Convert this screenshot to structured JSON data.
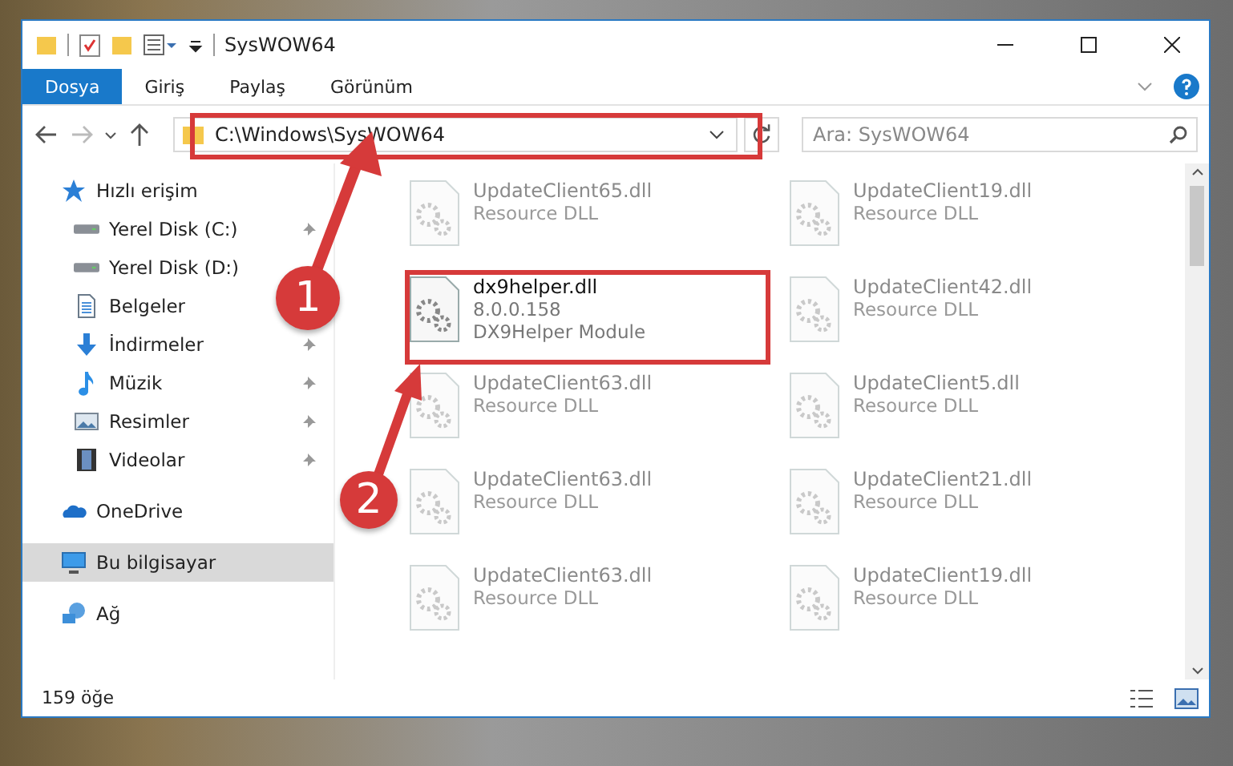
{
  "window": {
    "title": "SysWOW64"
  },
  "ribbon_tabs": [
    {
      "label": "Dosya",
      "selected": true
    },
    {
      "label": "Giriş",
      "selected": false
    },
    {
      "label": "Paylaş",
      "selected": false
    },
    {
      "label": "Görünüm",
      "selected": false
    }
  ],
  "address_bar": {
    "value": "C:\\Windows\\SysWOW64"
  },
  "search": {
    "placeholder": "Ara: SysWOW64"
  },
  "sidebar": {
    "items": [
      {
        "label": "Hızlı erişim",
        "kind": "star",
        "selected": false,
        "children": [
          {
            "label": "Yerel Disk (C:)",
            "kind": "drive",
            "pinned": true
          },
          {
            "label": "Yerel Disk (D:)",
            "kind": "drive",
            "pinned": false
          },
          {
            "label": "Belgeler",
            "kind": "documents",
            "pinned": false
          },
          {
            "label": "İndirmeler",
            "kind": "downloads",
            "pinned": true
          },
          {
            "label": "Müzik",
            "kind": "music",
            "pinned": true
          },
          {
            "label": "Resimler",
            "kind": "pictures",
            "pinned": true
          },
          {
            "label": "Videolar",
            "kind": "videos",
            "pinned": true
          }
        ]
      },
      {
        "label": "OneDrive",
        "kind": "cloud",
        "selected": false
      },
      {
        "label": "Bu bilgisayar",
        "kind": "computer",
        "selected": true
      },
      {
        "label": "Ağ",
        "kind": "network",
        "selected": false
      }
    ]
  },
  "files": [
    {
      "name": "UpdateClient65.dll",
      "lines": [
        "Resource DLL"
      ],
      "dimmed": true
    },
    {
      "name": "UpdateClient19.dll",
      "lines": [
        "Resource DLL"
      ],
      "dimmed": true
    },
    {
      "name": "dx9helper.dll",
      "lines": [
        "8.0.0.158",
        "DX9Helper Module"
      ],
      "dimmed": false
    },
    {
      "name": "UpdateClient42.dll",
      "lines": [
        "Resource DLL"
      ],
      "dimmed": true
    },
    {
      "name": "UpdateClient63.dll",
      "lines": [
        "Resource DLL"
      ],
      "dimmed": true
    },
    {
      "name": "UpdateClient5.dll",
      "lines": [
        "Resource DLL"
      ],
      "dimmed": true
    },
    {
      "name": "UpdateClient63.dll",
      "lines": [
        "Resource DLL"
      ],
      "dimmed": true
    },
    {
      "name": "UpdateClient21.dll",
      "lines": [
        "Resource DLL"
      ],
      "dimmed": true
    },
    {
      "name": "UpdateClient63.dll",
      "lines": [
        "Resource DLL"
      ],
      "dimmed": true
    },
    {
      "name": "UpdateClient19.dll",
      "lines": [
        "Resource DLL"
      ],
      "dimmed": true
    }
  ],
  "status_bar": {
    "count": "159 öğe"
  },
  "annotations": [
    {
      "number": "1"
    },
    {
      "number": "2"
    }
  ]
}
